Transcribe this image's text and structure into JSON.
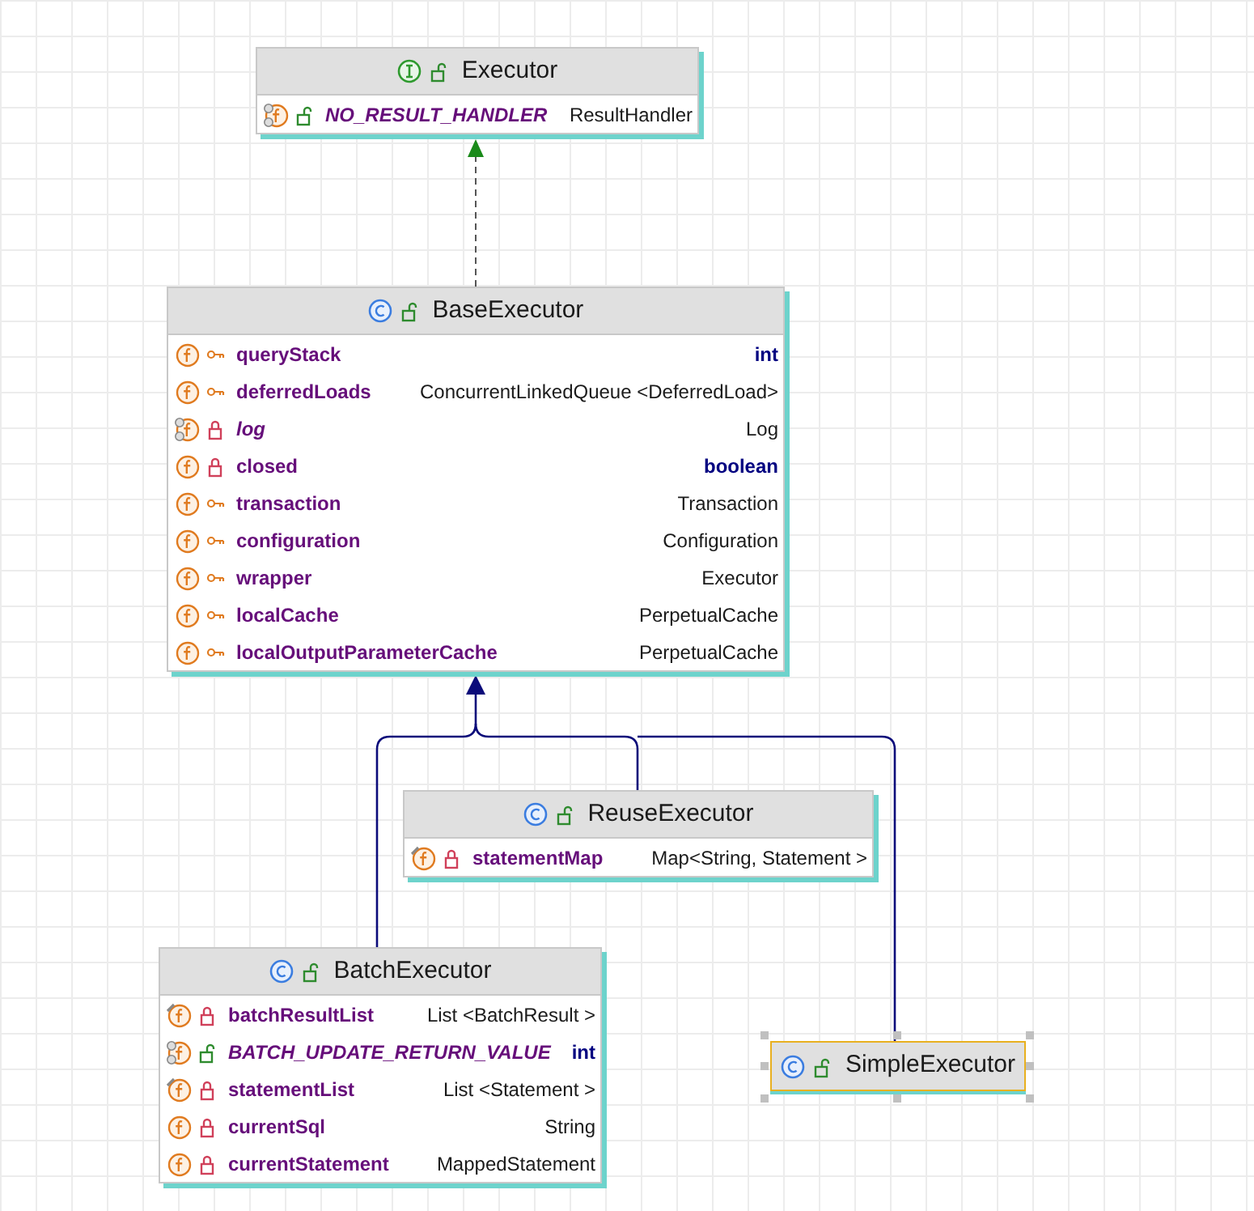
{
  "nodes": [
    {
      "kind": "interface",
      "name": "Executor",
      "selected": false,
      "fields": [
        {
          "name": "NO_RESULT_HANDLER",
          "type": "ResultHandler",
          "kind": "public",
          "static": true,
          "primitive": false
        }
      ]
    },
    {
      "kind": "class",
      "name": "BaseExecutor",
      "selected": false,
      "fields": [
        {
          "name": "queryStack",
          "type": "int",
          "kind": "protected",
          "static": false,
          "primitive": true
        },
        {
          "name": "deferredLoads",
          "type": "ConcurrentLinkedQueue <DeferredLoad>",
          "kind": "protected",
          "static": false,
          "primitive": false
        },
        {
          "name": "log",
          "type": "Log",
          "kind": "private",
          "static": true,
          "primitive": false
        },
        {
          "name": "closed",
          "type": "boolean",
          "kind": "private",
          "static": false,
          "primitive": true
        },
        {
          "name": "transaction",
          "type": "Transaction",
          "kind": "protected",
          "static": false,
          "primitive": false
        },
        {
          "name": "configuration",
          "type": "Configuration",
          "kind": "protected",
          "static": false,
          "primitive": false
        },
        {
          "name": "wrapper",
          "type": "Executor",
          "kind": "protected",
          "static": false,
          "primitive": false
        },
        {
          "name": "localCache",
          "type": "PerpetualCache",
          "kind": "protected",
          "static": false,
          "primitive": false
        },
        {
          "name": "localOutputParameterCache",
          "type": "PerpetualCache",
          "kind": "protected",
          "static": false,
          "primitive": false
        }
      ]
    },
    {
      "kind": "class",
      "name": "ReuseExecutor",
      "selected": false,
      "fields": [
        {
          "name": "statementMap",
          "type": "Map<String, Statement >",
          "kind": "private",
          "static": false,
          "final": true,
          "primitive": false
        }
      ]
    },
    {
      "kind": "class",
      "name": "BatchExecutor",
      "selected": false,
      "fields": [
        {
          "name": "batchResultList",
          "type": "List <BatchResult >",
          "kind": "private",
          "static": false,
          "final": true,
          "primitive": false
        },
        {
          "name": "BATCH_UPDATE_RETURN_VALUE",
          "type": "int",
          "kind": "public",
          "static": true,
          "primitive": true
        },
        {
          "name": "statementList",
          "type": "List <Statement >",
          "kind": "private",
          "static": false,
          "final": true,
          "primitive": false
        },
        {
          "name": "currentSql",
          "type": "String",
          "kind": "private",
          "static": false,
          "primitive": false
        },
        {
          "name": "currentStatement",
          "type": "MappedStatement",
          "kind": "private",
          "static": false,
          "primitive": false
        }
      ]
    },
    {
      "kind": "class",
      "name": "SimpleExecutor",
      "selected": true
    }
  ]
}
